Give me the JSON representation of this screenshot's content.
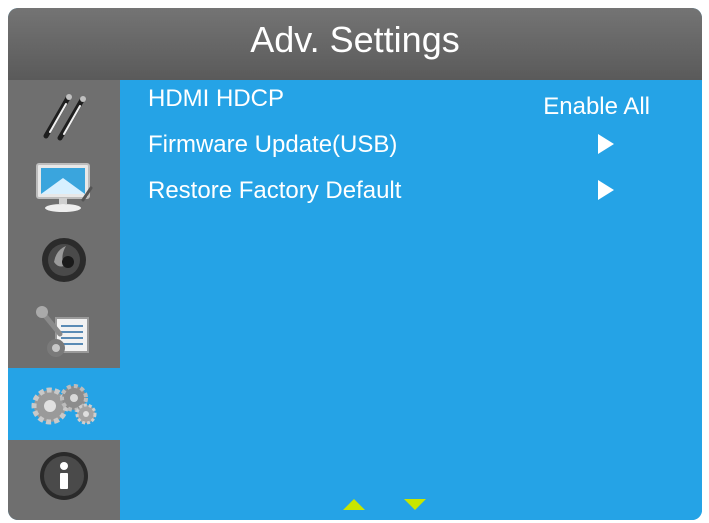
{
  "title": "Adv. Settings",
  "sidebar": {
    "items": [
      {
        "icon": "brushes-icon"
      },
      {
        "icon": "monitor-icon"
      },
      {
        "icon": "audio-icon"
      },
      {
        "icon": "tools-icon"
      },
      {
        "icon": "gears-icon",
        "active": true
      },
      {
        "icon": "info-icon"
      }
    ]
  },
  "menu": {
    "items": [
      {
        "label": "HDMI HDCP",
        "value": "Enable All"
      },
      {
        "label": "Firmware Update(USB)",
        "arrow": "right-arrow-icon"
      },
      {
        "label": "Restore Factory Default",
        "arrow": "right-arrow-icon"
      }
    ]
  },
  "scroll": {
    "up": "up-arrow-icon",
    "down": "down-arrow-icon"
  },
  "colors": {
    "title_bar": "#5f5f5f",
    "sidebar": "#6f6f6f",
    "content": "#25a3e6",
    "text": "#ffffff",
    "scroll_arrows": "#c8e600"
  }
}
